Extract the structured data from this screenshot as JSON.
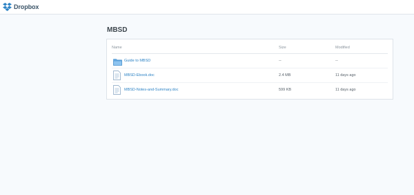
{
  "app": {
    "logo_text": "Dropbox",
    "brand_color": "#2d83c5",
    "logo_icon": "dropbox-box-icon"
  },
  "folder": {
    "title": "MBSD"
  },
  "table": {
    "headers": {
      "name": "Name",
      "size": "Size",
      "modified": "Modified"
    },
    "rows": [
      {
        "icon": "folder-icon",
        "name": "Guide to MBSD",
        "size": "--",
        "modified": "--"
      },
      {
        "icon": "document-icon",
        "name": "MBSD-Ebook.doc",
        "size": "2.4 MB",
        "modified": "11 days ago"
      },
      {
        "icon": "document-icon",
        "name": "MBSD-Notes-and-Summary.doc",
        "size": "599 KB",
        "modified": "11 days ago"
      }
    ]
  }
}
